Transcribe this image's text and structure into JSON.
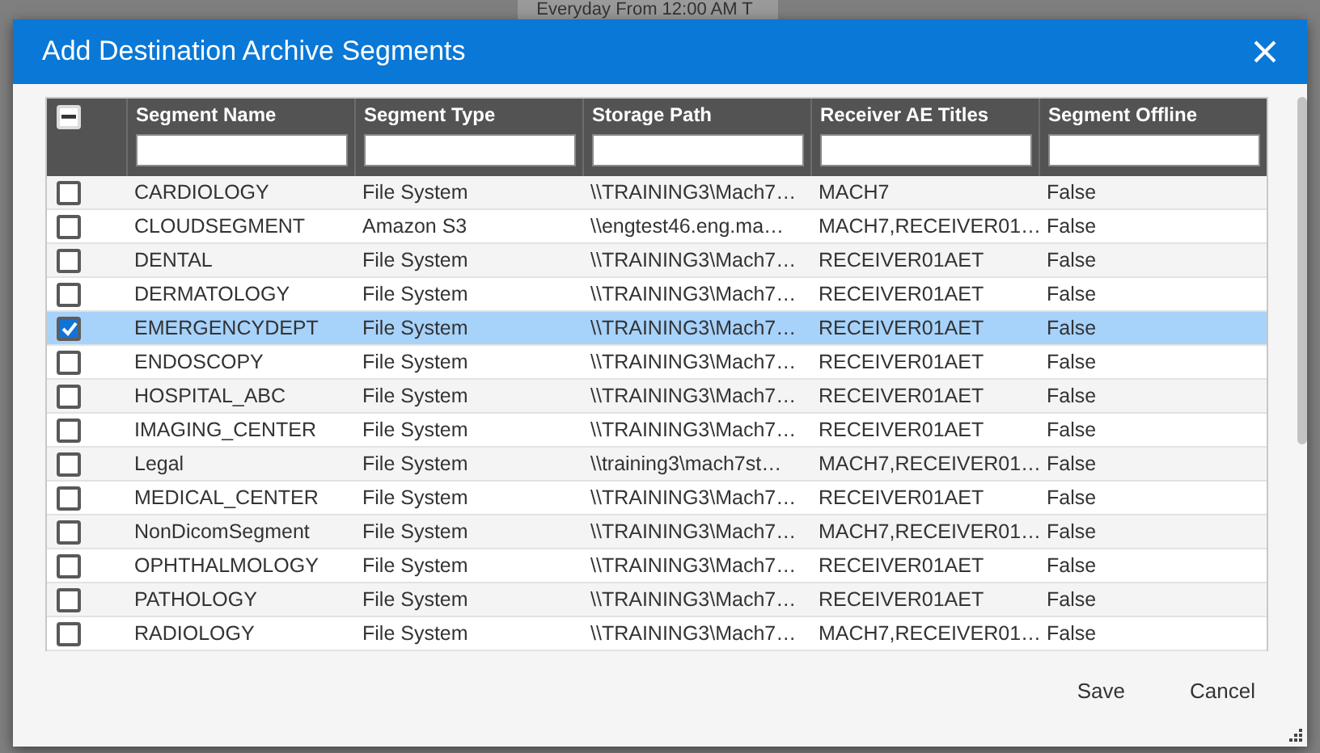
{
  "background": {
    "text": "Everyday From 12:00 AM T"
  },
  "dialog": {
    "title": "Add Destination Archive Segments",
    "table": {
      "header_checkbox": {
        "indeterminate": true
      },
      "columns": [
        "Segment Name",
        "Segment Type",
        "Storage Path",
        "Receiver AE Titles",
        "Segment Offline"
      ],
      "rows": [
        {
          "checked": false,
          "selected": false,
          "cells": [
            "CARDIOLOGY",
            "File System",
            "\\\\TRAINING3\\Mach7…",
            "MACH7",
            "False"
          ]
        },
        {
          "checked": false,
          "selected": false,
          "cells": [
            "CLOUDSEGMENT",
            "Amazon S3",
            "\\\\engtest46.eng.ma…",
            "MACH7,RECEIVER01…",
            "False"
          ]
        },
        {
          "checked": false,
          "selected": false,
          "cells": [
            "DENTAL",
            "File System",
            "\\\\TRAINING3\\Mach7…",
            "RECEIVER01AET",
            "False"
          ]
        },
        {
          "checked": false,
          "selected": false,
          "cells": [
            "DERMATOLOGY",
            "File System",
            "\\\\TRAINING3\\Mach7…",
            "RECEIVER01AET",
            "False"
          ]
        },
        {
          "checked": true,
          "selected": true,
          "cells": [
            "EMERGENCYDEPT",
            "File System",
            "\\\\TRAINING3\\Mach7…",
            "RECEIVER01AET",
            "False"
          ]
        },
        {
          "checked": false,
          "selected": false,
          "cells": [
            "ENDOSCOPY",
            "File System",
            "\\\\TRAINING3\\Mach7…",
            "RECEIVER01AET",
            "False"
          ]
        },
        {
          "checked": false,
          "selected": false,
          "cells": [
            "HOSPITAL_ABC",
            "File System",
            "\\\\TRAINING3\\Mach7…",
            "RECEIVER01AET",
            "False"
          ]
        },
        {
          "checked": false,
          "selected": false,
          "cells": [
            "IMAGING_CENTER",
            "File System",
            "\\\\TRAINING3\\Mach7…",
            "RECEIVER01AET",
            "False"
          ]
        },
        {
          "checked": false,
          "selected": false,
          "cells": [
            "Legal",
            "File System",
            "\\\\training3\\mach7st…",
            "MACH7,RECEIVER01…",
            "False"
          ]
        },
        {
          "checked": false,
          "selected": false,
          "cells": [
            "MEDICAL_CENTER",
            "File System",
            "\\\\TRAINING3\\Mach7…",
            "RECEIVER01AET",
            "False"
          ]
        },
        {
          "checked": false,
          "selected": false,
          "cells": [
            "NonDicomSegment",
            "File System",
            "\\\\TRAINING3\\Mach7…",
            "MACH7,RECEIVER01…",
            "False"
          ]
        },
        {
          "checked": false,
          "selected": false,
          "cells": [
            "OPHTHALMOLOGY",
            "File System",
            "\\\\TRAINING3\\Mach7…",
            "RECEIVER01AET",
            "False"
          ]
        },
        {
          "checked": false,
          "selected": false,
          "cells": [
            "PATHOLOGY",
            "File System",
            "\\\\TRAINING3\\Mach7…",
            "RECEIVER01AET",
            "False"
          ]
        },
        {
          "checked": false,
          "selected": false,
          "cells": [
            "RADIOLOGY",
            "File System",
            "\\\\TRAINING3\\Mach7…",
            "MACH7,RECEIVER01…",
            "False"
          ]
        }
      ]
    },
    "buttons": [
      "Save",
      "Cancel"
    ]
  }
}
